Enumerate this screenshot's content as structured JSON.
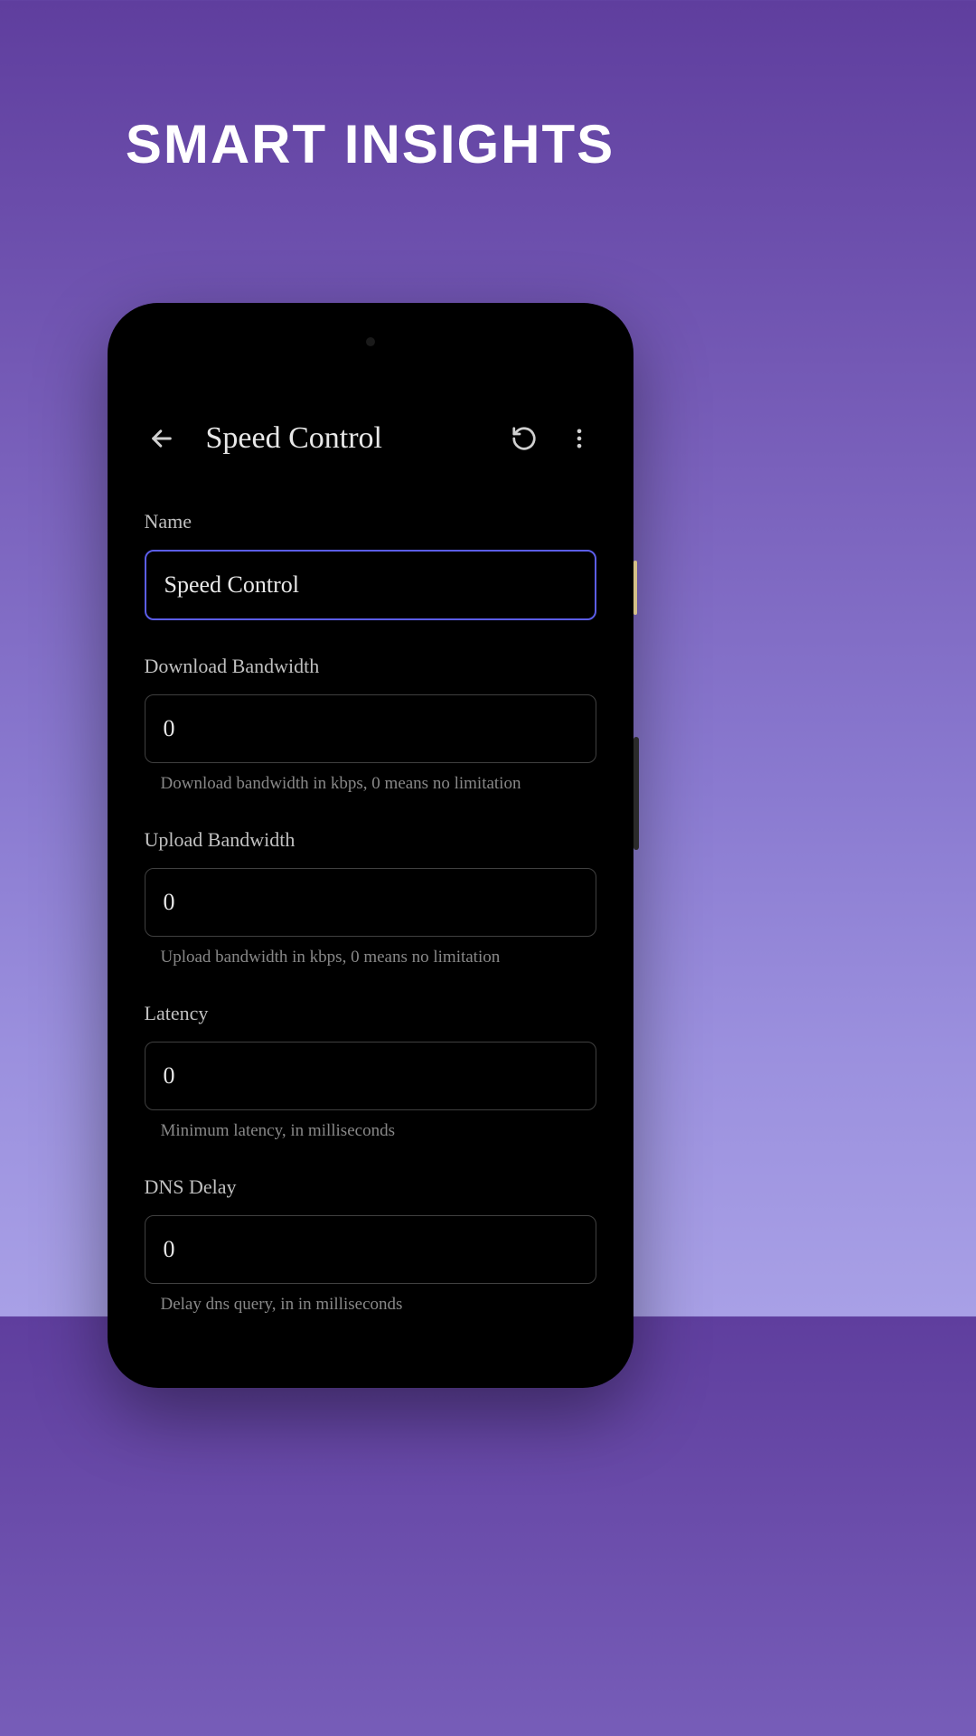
{
  "hero": {
    "title": "SMART INSIGHTS"
  },
  "app": {
    "toolbar": {
      "title": "Speed Control"
    },
    "fields": {
      "name": {
        "label": "Name",
        "value": "Speed Control"
      },
      "download": {
        "label": "Download Bandwidth",
        "value": "0",
        "hint": "Download bandwidth in kbps, 0 means no limitation"
      },
      "upload": {
        "label": "Upload Bandwidth",
        "value": "0",
        "hint": "Upload bandwidth in kbps, 0 means no limitation"
      },
      "latency": {
        "label": "Latency",
        "value": "0",
        "hint": "Minimum latency, in milliseconds"
      },
      "dnsDelay": {
        "label": "DNS Delay",
        "value": "0",
        "hint": "Delay dns query, in in milliseconds"
      }
    }
  }
}
